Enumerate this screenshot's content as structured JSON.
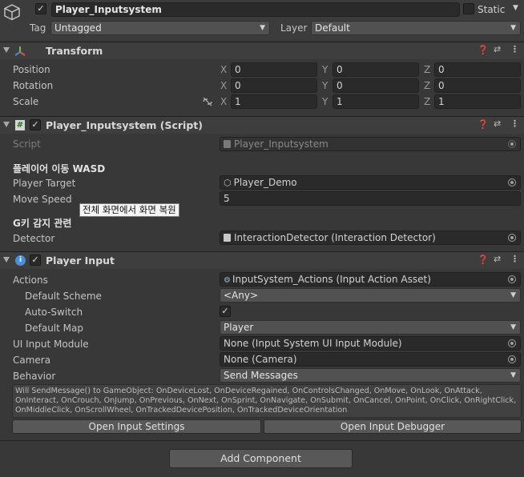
{
  "object": {
    "name": "Player_Inputsystem",
    "static_label": "Static",
    "tag_label": "Tag",
    "tag_value": "Untagged",
    "layer_label": "Layer",
    "layer_value": "Default"
  },
  "transform": {
    "title": "Transform",
    "rows": [
      {
        "label": "Position",
        "x": "0",
        "y": "0",
        "z": "0"
      },
      {
        "label": "Rotation",
        "x": "0",
        "y": "0",
        "z": "0"
      },
      {
        "label": "Scale",
        "x": "1",
        "y": "1",
        "z": "1"
      }
    ],
    "axis_x": "X",
    "axis_y": "Y",
    "axis_z": "Z"
  },
  "script_component": {
    "title": "Player_Inputsystem (Script)",
    "script_label": "Script",
    "script_value": "Player_Inputsystem",
    "section_move": "플레이어 이동 WASD",
    "player_target_label": "Player Target",
    "player_target_value": "Player_Demo",
    "move_speed_label": "Move Speed",
    "move_speed_value": "5",
    "tooltip": "전체 화면에서 화면 복원",
    "section_detect": "G키 감지 관련",
    "detector_label": "Detector",
    "detector_value": "InteractionDetector (Interaction Detector)"
  },
  "player_input": {
    "title": "Player Input",
    "actions_label": "Actions",
    "actions_value": "InputSystem_Actions (Input Action Asset)",
    "default_scheme_label": "Default Scheme",
    "default_scheme_value": "<Any>",
    "auto_switch_label": "Auto-Switch",
    "auto_switch_checked": true,
    "default_map_label": "Default Map",
    "default_map_value": "Player",
    "ui_module_label": "UI Input Module",
    "ui_module_value": "None (Input System UI Input Module)",
    "camera_label": "Camera",
    "camera_value": "None (Camera)",
    "behavior_label": "Behavior",
    "behavior_value": "Send Messages",
    "help_line1": "Will SendMessage() to GameObject: OnDeviceLost, OnDeviceRegained, OnControlsChanged, OnMove, OnLook, OnAttack,",
    "help_line2": "OnInteract, OnCrouch, OnJump, OnPrevious, OnNext, OnSprint, OnNavigate, OnSubmit, OnCancel, OnPoint, OnClick, OnRightClick,",
    "help_line3": "OnMiddleClick, OnScrollWheel, OnTrackedDevicePosition, OnTrackedDeviceOrientation",
    "open_settings_label": "Open Input Settings",
    "open_debugger_label": "Open Input Debugger"
  },
  "add_component_label": "Add Component",
  "icons": {
    "cube": "gameobject-cube-icon",
    "transform": "transform-axes-icon",
    "script": "csharp-script-icon",
    "player_input": "player-input-icon",
    "help": "help-icon",
    "settings": "preset-sliders-icon",
    "menu": "kebab-menu-icon",
    "link": "constrain-proportions-icon"
  },
  "colors": {
    "background": "#383838",
    "header": "#3e3e3e",
    "field": "#2a2a2a",
    "accent_transform": "#e0a040"
  }
}
